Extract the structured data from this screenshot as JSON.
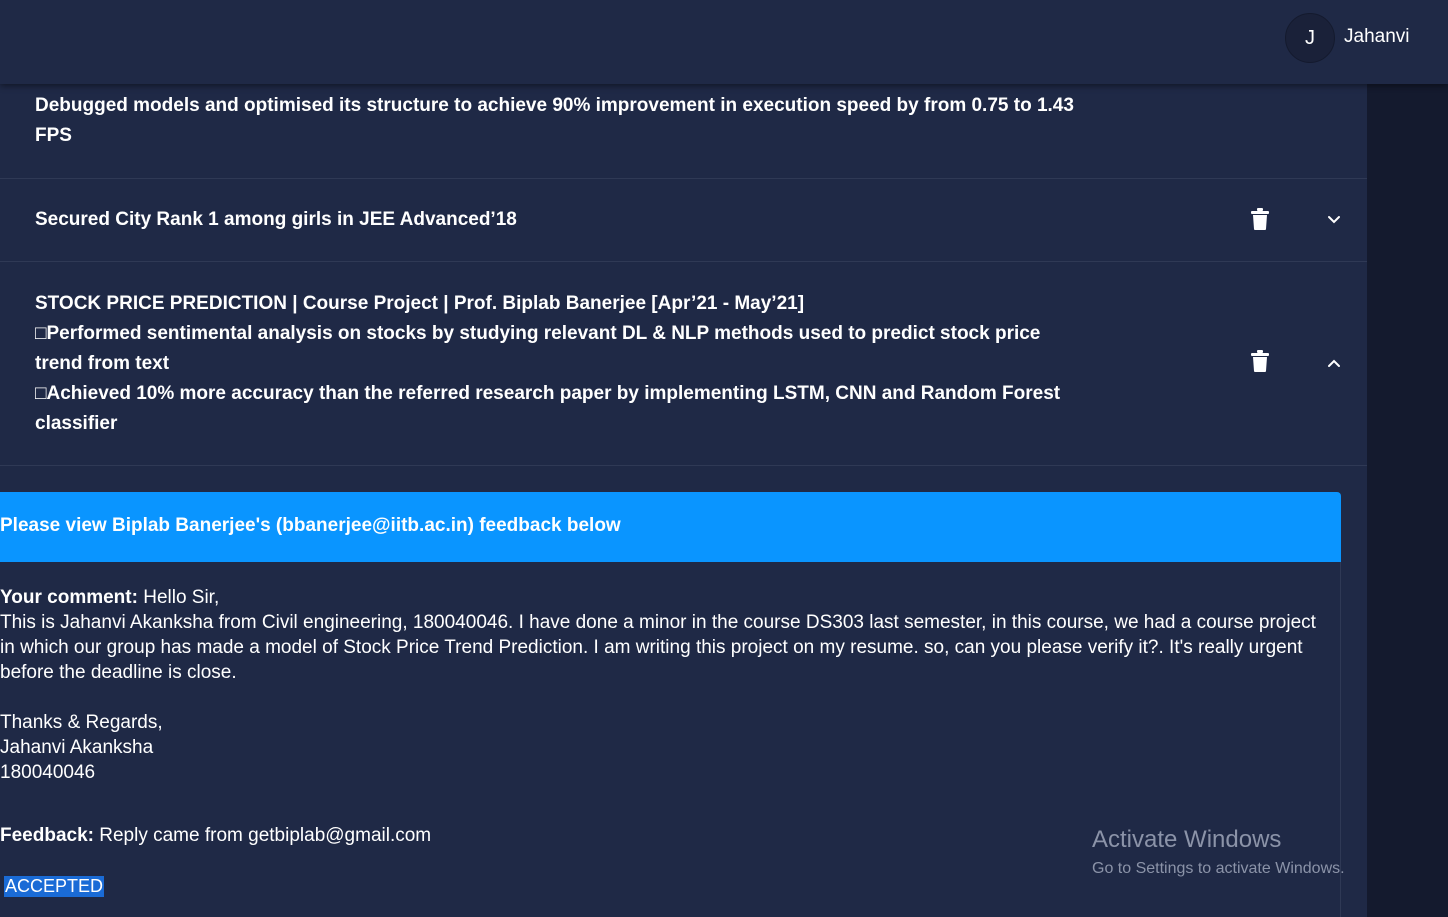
{
  "header": {
    "avatar_initial": "J",
    "username": "Jahanvi"
  },
  "items": [
    {
      "text_lines": [
        "Debugged models and optimised its structure to achieve 90% improvement in execution speed by from 0.75 to 1.43",
        "FPS"
      ]
    },
    {
      "text_lines": [
        "Secured City Rank 1 among girls in JEE Advanced’18"
      ],
      "expanded": false
    },
    {
      "text_lines": [
        "STOCK PRICE PREDICTION | Course Project | Prof. Biplab Banerjee [Apr’21 - May’21]",
        "□Performed sentimental analysis on stocks by studying relevant DL & NLP methods used to predict stock price",
        "trend from text",
        "□Achieved 10% more accuracy than the referred research paper by implementing LSTM, CNN and Random Forest",
        "classifier"
      ],
      "expanded": true
    }
  ],
  "feedback": {
    "header": "Please view Biplab Banerjee's (bbanerjee@iitb.ac.in) feedback below",
    "comment_label": "Your comment:",
    "comment_text": " Hello Sir,\nThis is Jahanvi Akanksha from Civil engineering, 180040046. I have done a minor in the course DS303 last semester, in this course, we had a course project in which our group has made a model of Stock Price Trend Prediction. I am writing this project on my resume. so, can you please verify it?. It's really urgent before the deadline is close.\n\nThanks & Regards,\nJahanvi Akanksha\n180040046",
    "feedback_label": "Feedback:",
    "feedback_text": " Reply came from getbiplab@gmail.com",
    "status": "ACCEPTED"
  },
  "watermark": {
    "title": "Activate Windows",
    "subtitle": "Go to Settings to activate Windows."
  },
  "colors": {
    "background": "#1f2946",
    "feedback_header": "#0a95ff",
    "status_highlight": "#1a6bd6"
  },
  "icons": [
    "trash-icon",
    "chevron-down-icon",
    "chevron-up-icon"
  ]
}
